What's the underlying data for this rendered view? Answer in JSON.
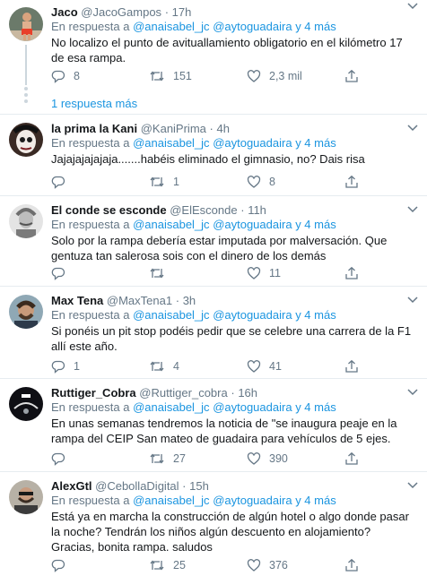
{
  "common": {
    "reply_prefix": "En respuesta a",
    "mention_1": "@anaisabel_jc",
    "mention_2": "@aytoguadaira",
    "and_more": "y 4 más",
    "dot": "·"
  },
  "tweets": [
    {
      "name": "Jaco",
      "handle": "@JacoGampos",
      "time": "17h",
      "text": "No localizo el punto de avituallamiento obligatorio en el kilómetro 17 de esa rampa.",
      "replies": "8",
      "retweets": "151",
      "likes": "2,3 mil",
      "more_replies": "1 respuesta más"
    },
    {
      "name": "la prima la Kani",
      "handle": "@KaniPrima",
      "time": "4h",
      "text": "Jajajajajajaja.......habéis eliminado el gimnasio, no? Dais risa",
      "replies": "",
      "retweets": "1",
      "likes": "8"
    },
    {
      "name": "El conde se esconde",
      "handle": "@ElEsconde",
      "time": "11h",
      "text": "Solo por la rampa debería estar imputada por malversación. Que gentuza tan salerosa sois con el dinero de los demás",
      "replies": "",
      "retweets": "",
      "likes": "11"
    },
    {
      "name": "Max Tena",
      "handle": "@MaxTena1",
      "time": "3h",
      "text": "Si ponéis un pit stop podéis pedir que se celebre una carrera de la F1 allí este año.",
      "replies": "1",
      "retweets": "4",
      "likes": "41"
    },
    {
      "name": "Ruttiger_Cobra",
      "handle": "@Ruttiger_cobra",
      "time": "16h",
      "text": "En unas semanas tendremos la noticia de \"se inaugura peaje en la rampa del CEIP San mateo de guadaira para vehículos de 5 ejes.",
      "replies": "",
      "retweets": "27",
      "likes": "390"
    },
    {
      "name": "AlexGtl",
      "handle": "@CebollaDigital",
      "time": "15h",
      "text": "Está ya en marcha la construcción de algún hotel o algo donde pasar la noche? Tendrán los niños algún descuento en alojamiento? Gracias, bonita rampa. saludos",
      "replies": "",
      "retweets": "25",
      "likes": "376"
    }
  ]
}
